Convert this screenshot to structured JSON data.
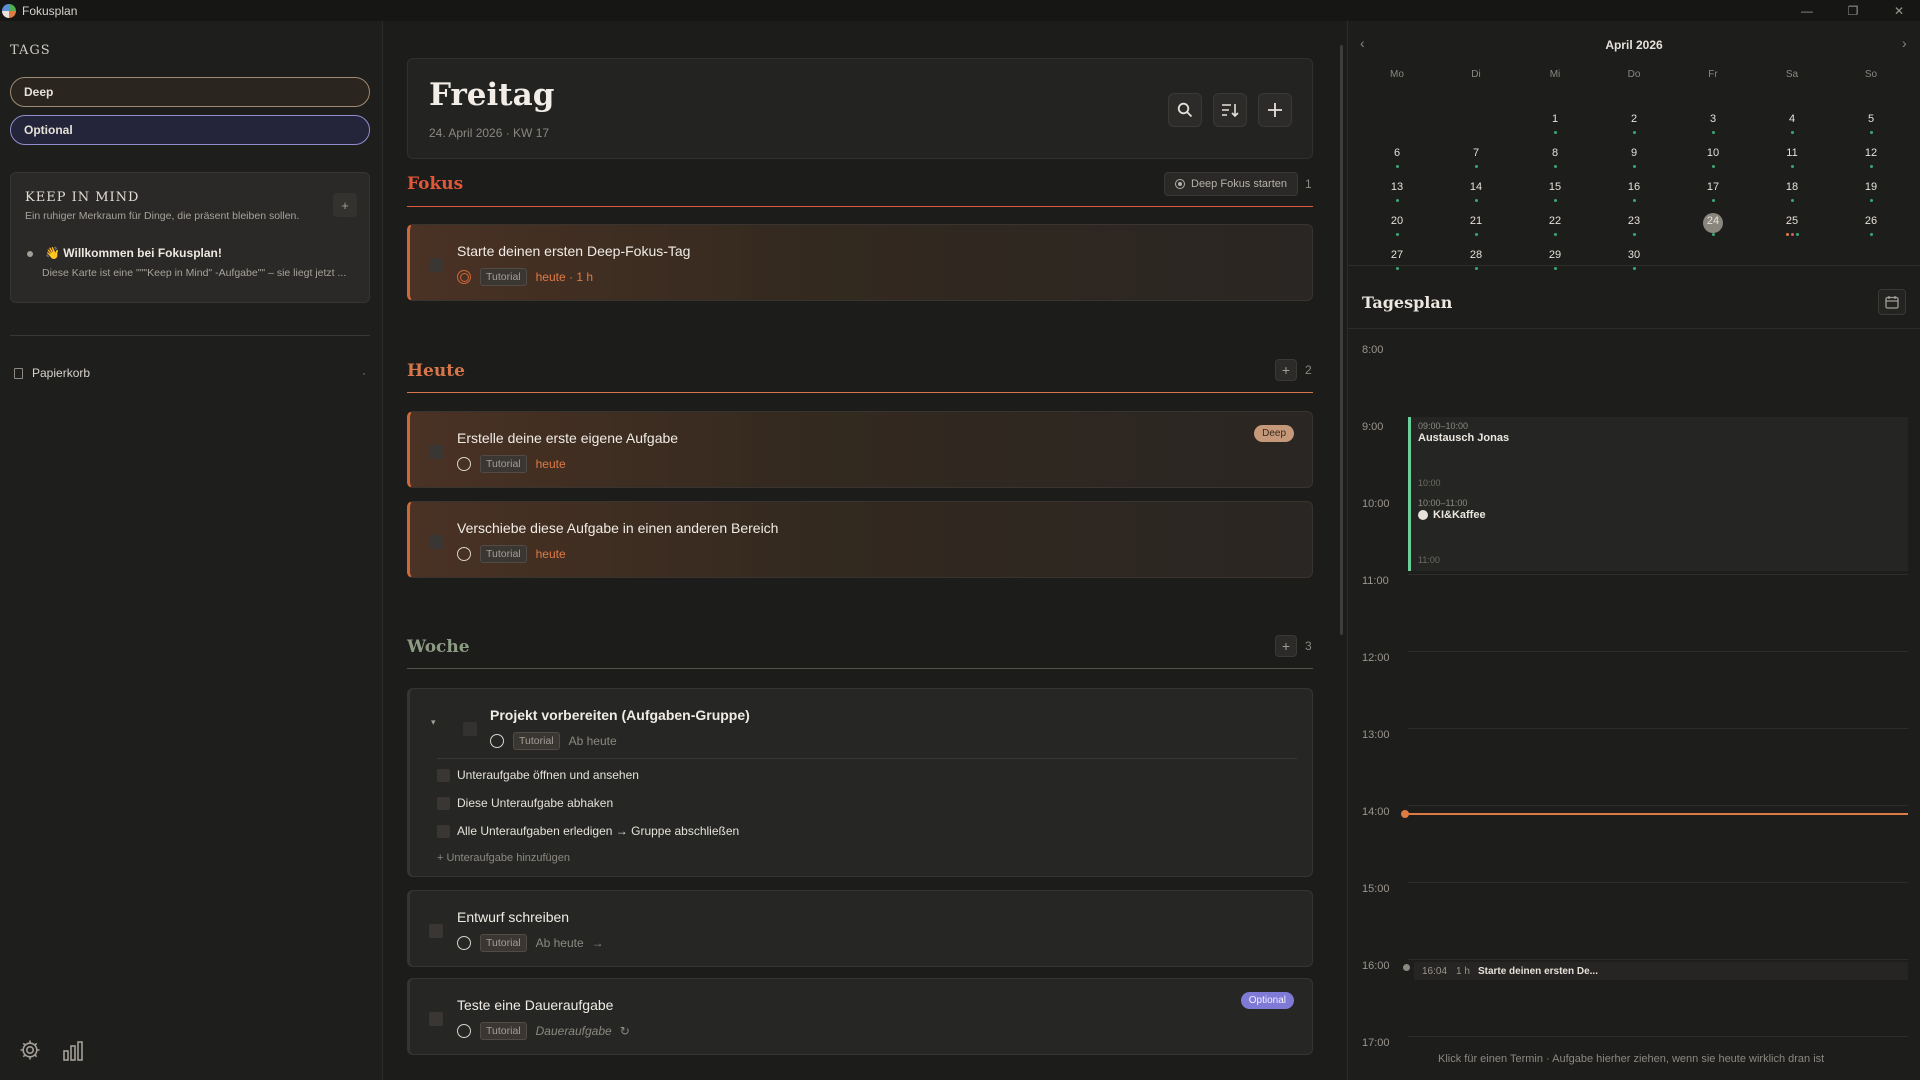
{
  "window": {
    "title": "Fokusplan",
    "controls": [
      "—",
      "❐",
      "✕"
    ]
  },
  "sidebar": {
    "tags_heading": "TAGS",
    "tags": [
      {
        "label": "Deep"
      },
      {
        "label": "Optional"
      }
    ],
    "keep_in_mind": {
      "title": "KEEP IN MIND",
      "subtitle": "Ein ruhiger Merkraum für Dinge, die präsent bleiben sollen.",
      "add_label": "+",
      "item_title": "👋 Willkommen bei Fokusplan!",
      "item_text": "Diese Karte ist eine \"\"\"Keep in Mind\" -Aufgabe\"\" – sie liegt jetzt ..."
    },
    "trash_label": "Papierkorb",
    "trash_more": "·"
  },
  "main": {
    "day_title": "Freitag",
    "day_date": "24. April 2026 · KW 17",
    "sections": {
      "fokus": {
        "title": "Fokus",
        "count": "1",
        "deep_button": "Deep Fokus starten",
        "tasks": [
          {
            "title": "Starte deinen ersten Deep-Fokus-Tag",
            "tag": "Tutorial",
            "due": "heute · 1 h"
          }
        ]
      },
      "heute": {
        "title": "Heute",
        "count": "2",
        "add": "+",
        "tasks": [
          {
            "title": "Erstelle deine erste eigene Aufgabe",
            "tag": "Tutorial",
            "due": "heute",
            "badge": "Deep"
          },
          {
            "title": "Verschiebe diese Aufgabe in einen anderen Bereich",
            "tag": "Tutorial",
            "due": "heute"
          }
        ]
      },
      "woche": {
        "title": "Woche",
        "count": "3",
        "add": "+",
        "group": {
          "title": "Projekt vorbereiten (Aufgaben-Gruppe)",
          "tag": "Tutorial",
          "due": "Ab heute",
          "subtasks": [
            "Unteraufgabe öffnen und ansehen",
            "Diese Unteraufgabe abhaken",
            "Alle Unteraufgaben erledigen → Gruppe abschließen"
          ],
          "add_subtask": "+ Unteraufgabe hinzufügen"
        },
        "tasks": [
          {
            "title": "Entwurf schreiben",
            "tag": "Tutorial",
            "due": "Ab heute",
            "arrow": "→"
          },
          {
            "title": "Teste eine Daueraufgabe",
            "tag": "Tutorial",
            "due": "Daueraufgabe",
            "repeat": "↻",
            "badge": "Optional"
          }
        ]
      }
    }
  },
  "calendar": {
    "prev": "‹",
    "next": "›",
    "month_label": "April 2026",
    "weekdays": [
      "Mo",
      "Di",
      "Mi",
      "Do",
      "Fr",
      "Sa",
      "So"
    ],
    "days": [
      "1",
      "2",
      "3",
      "4",
      "5",
      "6",
      "7",
      "8",
      "9",
      "10",
      "11",
      "12",
      "13",
      "14",
      "15",
      "16",
      "17",
      "18",
      "19",
      "20",
      "21",
      "22",
      "23",
      "24",
      "25",
      "26",
      "27",
      "28",
      "29",
      "30"
    ],
    "today": "24"
  },
  "day_plan": {
    "title": "Tagesplan",
    "hours": [
      "8:00",
      "9:00",
      "10:00",
      "11:00",
      "12:00",
      "13:00",
      "14:00",
      "15:00",
      "16:00",
      "17:00"
    ],
    "events": [
      {
        "time": "09:00–10:00",
        "title": "Austausch Jonas",
        "end": "10:00"
      },
      {
        "time": "10:00–11:00",
        "title": "KI&Kaffee",
        "end": "11:00"
      }
    ],
    "task_slot": {
      "time": "16:04",
      "duration": "1 h",
      "title": "Starte deinen ersten De..."
    },
    "hint": "Klick für einen Termin · Aufgabe hierher ziehen, wenn sie heute wirklich dran ist"
  },
  "colors": {
    "accent_orange": "#e07a44",
    "section_fokus": "#e0573a",
    "section_heute": "#d6764a",
    "section_woche": "#8e9b84",
    "event_green": "#6ccf9a",
    "badge_optional": "#7f7ad6",
    "badge_deep": "#c49878"
  },
  "icons": {
    "header": [
      "search-icon",
      "sort-icon",
      "plus-icon"
    ],
    "sidebar_bottom": [
      "gear-icon",
      "bar-chart-icon"
    ],
    "plan": "calendar-icon"
  }
}
